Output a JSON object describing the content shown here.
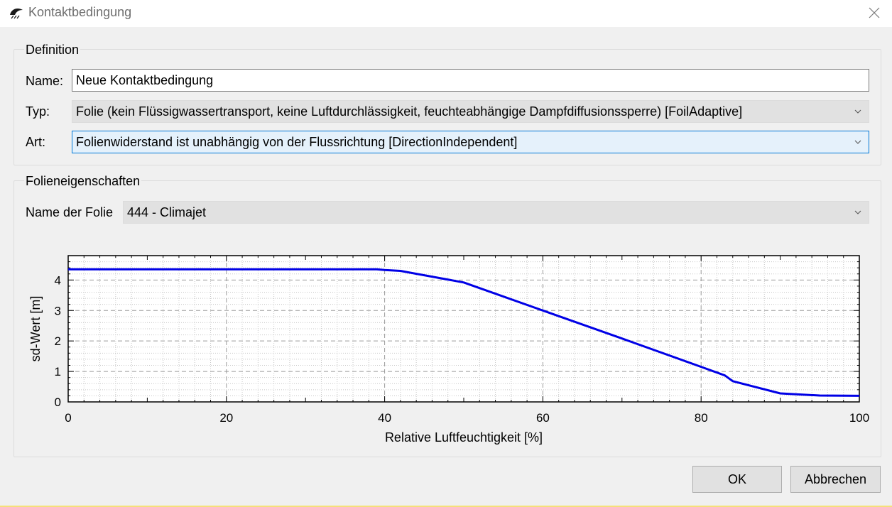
{
  "window": {
    "title": "Kontaktbedingung",
    "icon": "app-logo-icon",
    "close_icon": "close-icon"
  },
  "definition": {
    "group_title": "Definition",
    "name_label": "Name:",
    "name_value": "Neue Kontaktbedingung",
    "typ_label": "Typ:",
    "typ_value": "Folie (kein Flüssigwassertransport, keine Luftdurchlässigkeit, feuchteabhängige Dampfdiffusionssperre) [FoilAdaptive]",
    "art_label": "Art:",
    "art_value": "Folienwiderstand ist unabhängig von der Flussrichtung [DirectionIndependent]"
  },
  "foil": {
    "group_title": "Folieneigenschaften",
    "name_label": "Name der Folie",
    "name_value": "444 - Climajet"
  },
  "chart_data": {
    "type": "line",
    "xlabel": "Relative Luftfeuchtigkeit [%]",
    "ylabel": "sd-Wert [m]",
    "xlim": [
      0,
      100
    ],
    "ylim": [
      0,
      4.8
    ],
    "xticks": [
      "0",
      "20",
      "40",
      "60",
      "80",
      "100"
    ],
    "yticks": [
      "0",
      "1",
      "2",
      "3",
      "4"
    ],
    "grid": true,
    "series": [
      {
        "color": "#0000e6",
        "x": [
          0,
          39,
          40,
          42,
          50,
          60,
          70,
          80,
          83,
          84,
          90,
          92,
          95,
          100
        ],
        "y": [
          4.35,
          4.35,
          4.33,
          4.3,
          3.92,
          3.0,
          2.08,
          1.15,
          0.87,
          0.68,
          0.28,
          0.25,
          0.21,
          0.2
        ]
      }
    ]
  },
  "buttons": {
    "ok": "OK",
    "cancel": "Abbrechen"
  }
}
